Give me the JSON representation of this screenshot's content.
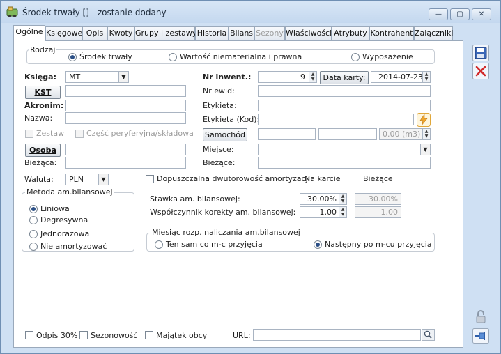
{
  "window": {
    "title": "Środek trwały [] - zostanie dodany",
    "minimize": "—",
    "maximize": "▢",
    "close": "✕"
  },
  "tabs": [
    "Ogólne",
    "Księgowe",
    "Opis",
    "Kwoty",
    "Grupy i zestawy",
    "Historia",
    "Bilans",
    "Sezony",
    "Właściwości",
    "Atrybuty",
    "Kontrahent",
    "Załączniki"
  ],
  "rodzaj": {
    "label": "Rodzaj",
    "options": [
      "Środek trwały",
      "Wartość niematerialna i prawna",
      "Wyposażenie"
    ],
    "selected": "Środek trwały"
  },
  "left": {
    "ksiega_label": "Księga:",
    "ksiega_value": "MT",
    "kst_button": "KŚT",
    "kst_value": "",
    "akronim_label": "Akronim:",
    "akronim_value": "",
    "nazwa_label": "Nazwa:",
    "nazwa_value": "",
    "zestaw_label": "Zestaw",
    "czesc_label": "Część peryferyjna/składowa",
    "osoba_button": "Osoba",
    "osoba_value": "",
    "biezaca_label": "Bieżąca:",
    "biezaca_value": ""
  },
  "right": {
    "nr_inwent_label": "Nr inwent.:",
    "nr_inwent_value": "9",
    "data_karty_button": "Data karty:",
    "data_karty_value": "2014-07-23",
    "nr_ewid_label": "Nr ewid:",
    "nr_ewid_value": "",
    "etykieta_label": "Etykieta:",
    "etykieta_value": "",
    "etykieta_kod_label": "Etykieta (Kod):",
    "etykieta_kod_value": "",
    "samochod_button": "Samochód",
    "samochod_value1": "",
    "samochod_value2": "",
    "samochod_value3": "0.00 (m3)",
    "miejsce_label": "Miejsce:",
    "miejsce_value": "",
    "biezace_label": "Bieżące:",
    "biezace_value": ""
  },
  "waluta": {
    "label": "Waluta:",
    "value": "PLN"
  },
  "amortyzacja": {
    "dwutorowosc_label": "Dopuszczalna dwutorowość amortyzacji",
    "na_karcie_header": "Na karcie",
    "biezace_header": "Bieżące",
    "stawka_label": "Stawka am. bilansowej:",
    "stawka_value": "30.00%",
    "stawka_biezaca": "30.00%",
    "wspolczynnik_label": "Współczynnik korekty am. bilansowej:",
    "wspolczynnik_value": "1.00",
    "wspolczynnik_biezacy": "1.00"
  },
  "metoda": {
    "label": "Metoda am.bilansowej",
    "options": [
      "Liniowa",
      "Degresywna",
      "Jednorazowa",
      "Nie amortyzować"
    ],
    "selected": "Liniowa"
  },
  "miesiac": {
    "label": "Miesiąc rozp. naliczania am.bilansowej",
    "options": [
      "Ten sam co m-c przyjęcia",
      "Następny po m-cu przyjęcia"
    ],
    "selected": "Następny po m-cu przyjęcia"
  },
  "footer": {
    "odpis_label": "Odpis 30%",
    "sezonowosc_label": "Sezonowość",
    "majatek_label": "Majątek obcy",
    "url_label": "URL:",
    "url_value": ""
  },
  "icons": {
    "app": "app-icon",
    "save": "floppy-disk-icon",
    "cancel": "red-x-icon",
    "lock": "padlock-icon",
    "pin": "pin-icon",
    "lightning": "lightning-icon",
    "search": "magnifier-icon"
  },
  "colors": {
    "accent": "#2b4f86",
    "cancel_red": "#d12a2a",
    "lightning": "#f0a62a"
  }
}
